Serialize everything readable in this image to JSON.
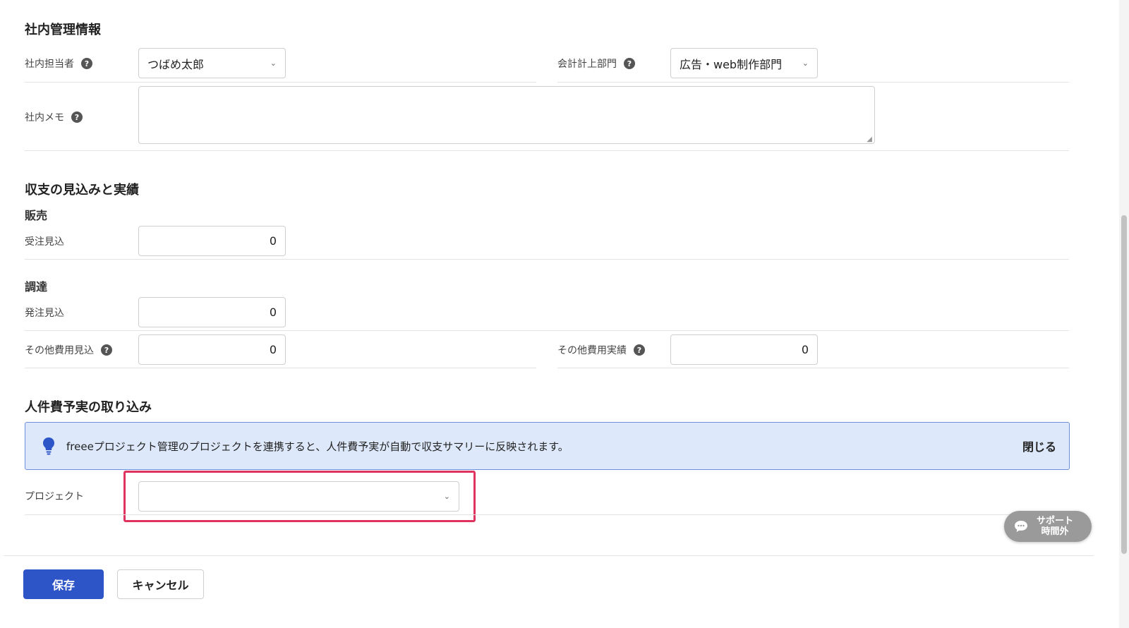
{
  "internal": {
    "title": "社内管理情報",
    "owner_label": "社内担当者",
    "owner_value": "つばめ太郎",
    "dept_label": "会計計上部門",
    "dept_value": "広告・web制作部門",
    "memo_label": "社内メモ",
    "memo_value": ""
  },
  "finance": {
    "title": "収支の見込みと実績",
    "sales_title": "販売",
    "order_forecast_label": "受注見込",
    "order_forecast_value": "0",
    "procurement_title": "調達",
    "purchase_forecast_label": "発注見込",
    "purchase_forecast_value": "0",
    "other_forecast_label": "その他費用見込",
    "other_forecast_value": "0",
    "other_actual_label": "その他費用実績",
    "other_actual_value": "0"
  },
  "labor": {
    "title": "人件費予実の取り込み",
    "info_text": "freeeプロジェクト管理のプロジェクトを連携すると、人件費予実が自動で収支サマリーに反映されます。",
    "close_label": "閉じる",
    "project_label": "プロジェクト",
    "project_value": ""
  },
  "footer": {
    "save_label": "保存",
    "cancel_label": "キャンセル"
  },
  "support": {
    "line1": "サポート",
    "line2": "時間外"
  },
  "icons": {
    "help": "?",
    "chevron": "⌄"
  },
  "colors": {
    "primary": "#2d55c8",
    "info_bg": "#dde9fb",
    "info_border": "#6b8fdc",
    "highlight": "#e0325e"
  }
}
